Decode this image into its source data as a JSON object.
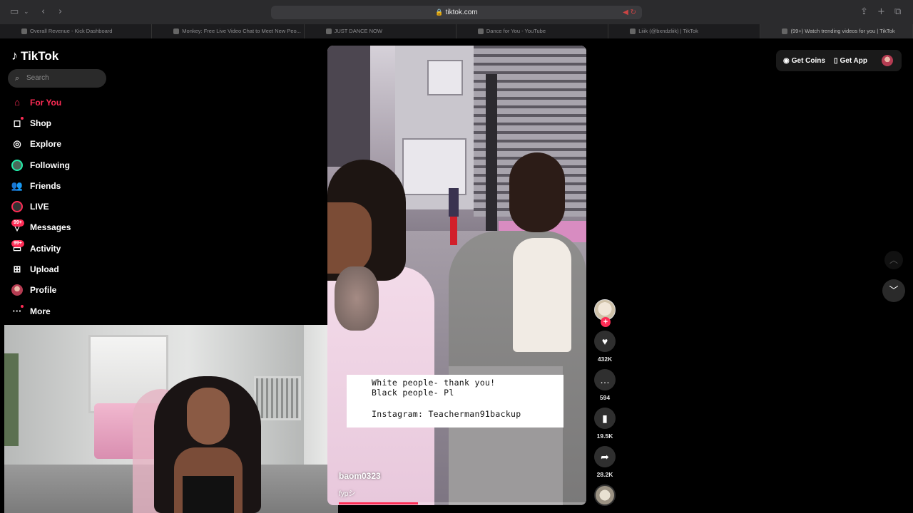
{
  "browser": {
    "url": "tiktok.com",
    "tabs": [
      {
        "title": "Overall Revenue - Kick Dashboard"
      },
      {
        "title": "Monkey: Free Live Video Chat to Meet New Peo..."
      },
      {
        "title": "JUST DANCE NOW"
      },
      {
        "title": "Dance for You - YouTube"
      },
      {
        "title": "Liiik (@bxndzliik) | TikTok"
      },
      {
        "title": "(99+) Watch trending videos for you | TikTok"
      }
    ]
  },
  "sidebar": {
    "logo": "TikTok",
    "search_placeholder": "Search",
    "items": [
      {
        "label": "For You",
        "icon": "home-icon"
      },
      {
        "label": "Shop",
        "icon": "shopping-bag-icon"
      },
      {
        "label": "Explore",
        "icon": "compass-icon"
      },
      {
        "label": "Following",
        "icon": "following-avatar-icon"
      },
      {
        "label": "Friends",
        "icon": "friends-icon"
      },
      {
        "label": "LIVE",
        "icon": "live-icon"
      },
      {
        "label": "Messages",
        "icon": "messages-icon",
        "badge": "99+"
      },
      {
        "label": "Activity",
        "icon": "activity-icon",
        "badge": "99+"
      },
      {
        "label": "Upload",
        "icon": "upload-icon"
      },
      {
        "label": "Profile",
        "icon": "profile-avatar-icon"
      },
      {
        "label": "More",
        "icon": "more-icon"
      }
    ]
  },
  "video": {
    "caption_line1": "White people- thank you!",
    "caption_line2": "Black people- Pl",
    "caption_line3": "Instagram: Teacherman91backup",
    "username": "baom0323",
    "hashtag": "fypシ",
    "progress_fraction": 0.32
  },
  "actions": {
    "likes": "432K",
    "comments": "594",
    "saves": "19.5K",
    "shares": "28.2K"
  },
  "header": {
    "get_coins": "Get Coins",
    "get_app": "Get App"
  },
  "colors": {
    "accent": "#fe2c55",
    "background": "#000000"
  }
}
